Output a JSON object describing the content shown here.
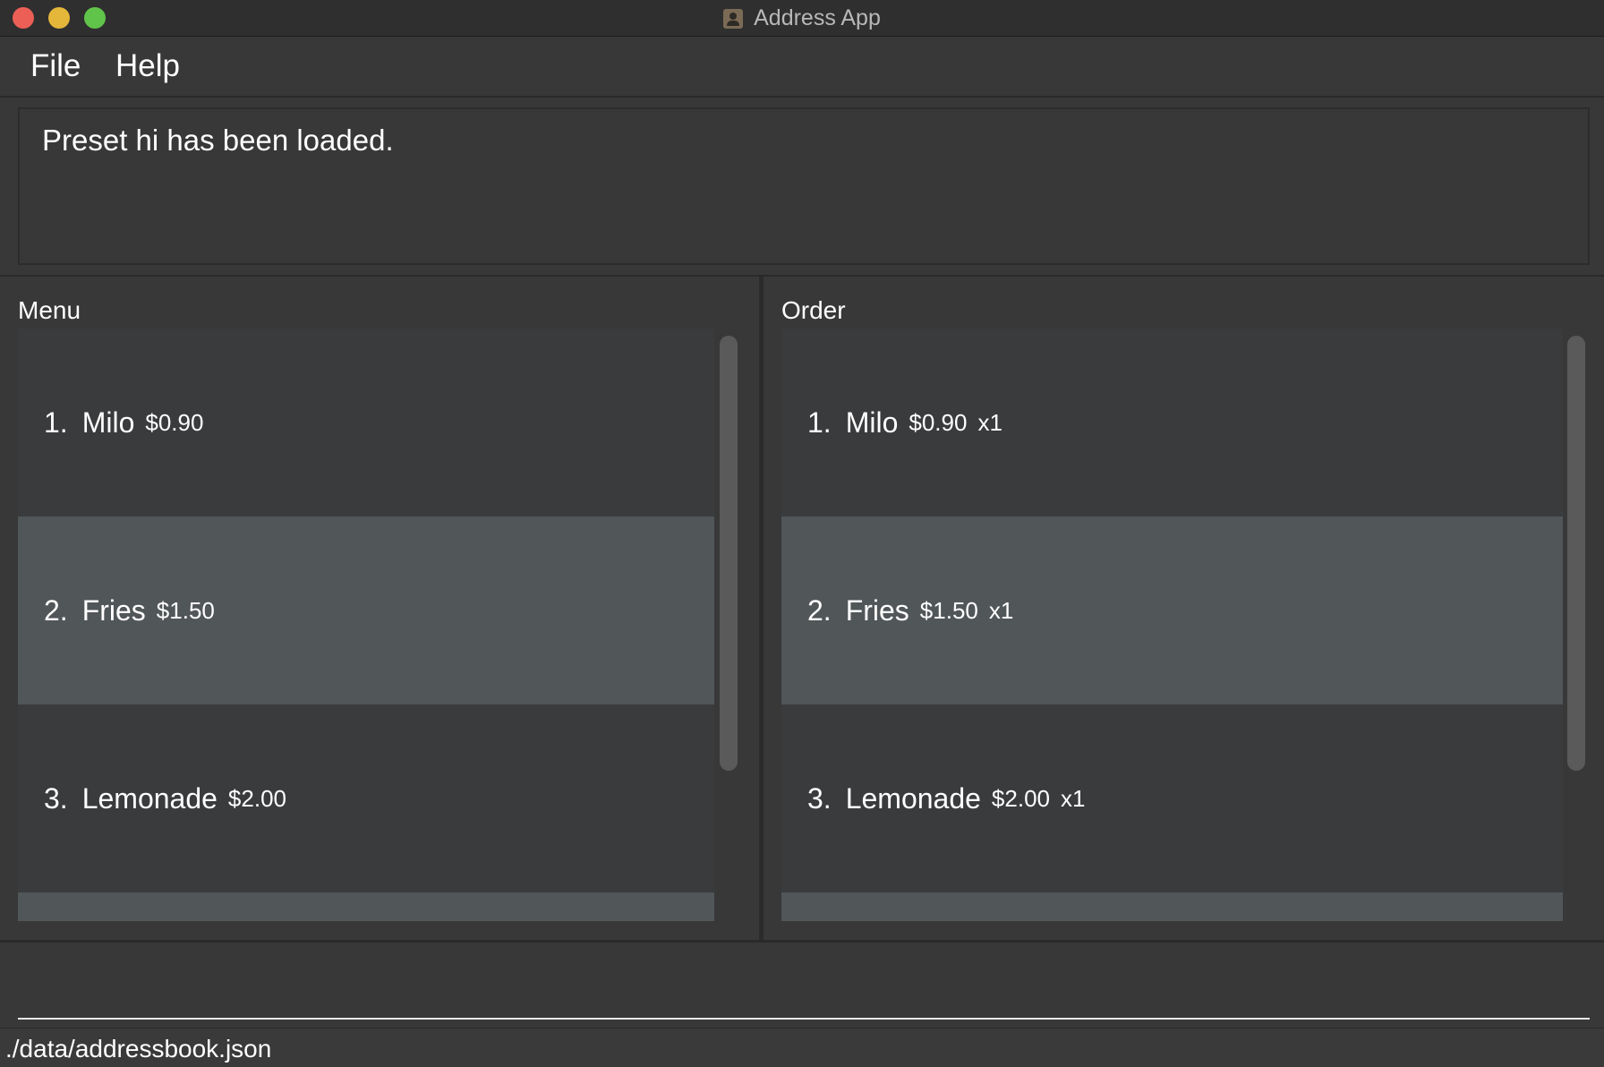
{
  "window": {
    "title": "Address App",
    "icon": "address-book-icon"
  },
  "menubar": {
    "file_label": "File",
    "help_label": "Help"
  },
  "result": {
    "message": "Preset hi has been loaded."
  },
  "menu_panel": {
    "label": "Menu",
    "items": [
      {
        "index": "1.",
        "name": "Milo",
        "price": "$0.90"
      },
      {
        "index": "2.",
        "name": "Fries",
        "price": "$1.50"
      },
      {
        "index": "3.",
        "name": "Lemonade",
        "price": "$2.00"
      }
    ]
  },
  "order_panel": {
    "label": "Order",
    "items": [
      {
        "index": "1.",
        "name": "Milo",
        "price": "$0.90",
        "qty": "x1"
      },
      {
        "index": "2.",
        "name": "Fries",
        "price": "$1.50",
        "qty": "x1"
      },
      {
        "index": "3.",
        "name": "Lemonade",
        "price": "$2.00",
        "qty": "x1"
      }
    ]
  },
  "command": {
    "value": "",
    "placeholder": ""
  },
  "status": {
    "file_path": "./data/addressbook.json"
  },
  "colors": {
    "close": "#ec5f57",
    "minimize": "#e4b63a",
    "maximize": "#61c44a",
    "background": "#383838",
    "row": "#3a3b3d",
    "row_alt": "#515658"
  }
}
